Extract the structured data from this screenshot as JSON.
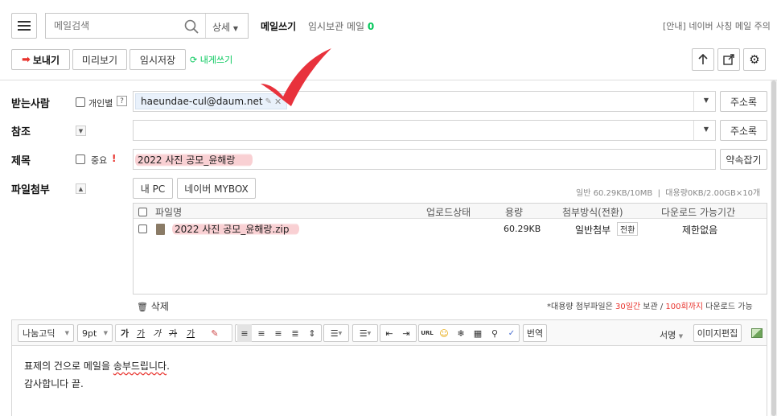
{
  "search": {
    "placeholder": "메일검색",
    "detail_label": "상세"
  },
  "header": {
    "compose_title": "메일쓰기",
    "draft_label": "임시보관 메일",
    "draft_count": "0",
    "notice": "[안내] 네이버 사칭 메일 주의"
  },
  "toolbar": {
    "send": "보내기",
    "preview": "미리보기",
    "save_draft": "임시저장",
    "to_self": "내게쓰기"
  },
  "recipients": {
    "label": "받는사람",
    "individual_label": "개인별",
    "help": "?",
    "chip": "haeundae-cul@daum.net",
    "address_book": "주소록"
  },
  "cc": {
    "label": "참조",
    "address_book": "주소록"
  },
  "subject": {
    "label": "제목",
    "important_label": "중요",
    "important_mark": "!",
    "value": "2022 사진 공모_윤해랑",
    "shortcut": "약속잡기"
  },
  "attach": {
    "label": "파일첨부",
    "my_pc": "내 PC",
    "mybox": "네이버 MYBOX",
    "usage": "일반 60.29KB/10MB  |  대용량0KB/2.00GB×10개",
    "columns": [
      "파일명",
      "업로드상태",
      "용량",
      "첨부방식(전환)",
      "다운로드 가능기간"
    ],
    "files": [
      {
        "name": "2022 사진 공모_윤해랑.zip",
        "status": "",
        "size": "60.29KB",
        "mode": "일반첨부",
        "switch": "전환",
        "period": "제한없음"
      }
    ],
    "delete": "삭제",
    "note_prefix": "*대용량 첨부파일은 ",
    "note_days": "30일간",
    "note_mid": " 보관 / ",
    "note_count": "100회까지",
    "note_suffix": " 다운로드 가능"
  },
  "editor": {
    "font": "나눔고딕",
    "size": "9pt",
    "bold": "가",
    "underline": "가",
    "italic": "가",
    "strike": "가",
    "color": "가",
    "translate": "번역",
    "signature": "서명",
    "image_edit": "이미지편집",
    "url": "URL",
    "body_line1_a": "표제의 건으로 메일을 ",
    "body_line1_b": "송부드립니다",
    "body_line1_c": ".",
    "body_line2": "감사합니다 끝."
  },
  "colors": {
    "accent_red": "#e8322c",
    "green": "#03c75a",
    "checkmark": "#e8323c"
  }
}
